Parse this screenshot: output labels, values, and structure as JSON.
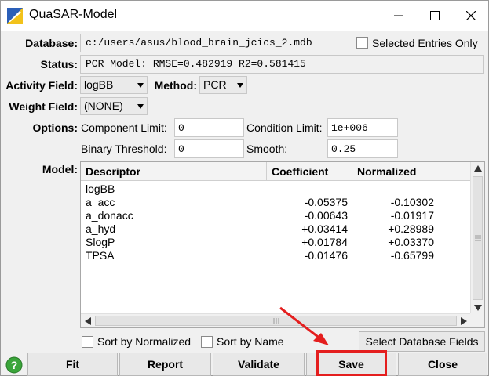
{
  "window": {
    "title": "QuaSAR-Model"
  },
  "labels": {
    "database": "Database:",
    "status": "Status:",
    "activity_field": "Activity Field:",
    "method": "Method:",
    "weight_field": "Weight Field:",
    "options": "Options:",
    "model": "Model:"
  },
  "database": {
    "path": "c:/users/asus/blood_brain_jcics_2.mdb",
    "selected_entries_only": "Selected Entries Only"
  },
  "status": {
    "text": "PCR Model: RMSE=0.482919 R2=0.581415"
  },
  "activity_field": {
    "value": "logBB"
  },
  "method": {
    "value": "PCR"
  },
  "weight_field": {
    "value": "(NONE)"
  },
  "options": {
    "component_limit_label": "Component Limit:",
    "component_limit": "0",
    "condition_limit_label": "Condition Limit:",
    "condition_limit": "1e+006",
    "binary_threshold_label": "Binary Threshold:",
    "binary_threshold": "0",
    "smooth_label": "Smooth:",
    "smooth": "0.25"
  },
  "model": {
    "columns": [
      "Descriptor",
      "Coefficient",
      "Normalized"
    ],
    "rows": [
      {
        "descriptor": "logBB",
        "coefficient": "",
        "normalized": ""
      },
      {
        "descriptor": "a_acc",
        "coefficient": "-0.05375",
        "normalized": "-0.10302"
      },
      {
        "descriptor": "a_donacc",
        "coefficient": "-0.00643",
        "normalized": "-0.01917"
      },
      {
        "descriptor": "a_hyd",
        "coefficient": "+0.03414",
        "normalized": "+0.28989"
      },
      {
        "descriptor": "SlogP",
        "coefficient": "+0.01784",
        "normalized": "+0.03370"
      },
      {
        "descriptor": "TPSA",
        "coefficient": "-0.01476",
        "normalized": "-0.65799"
      }
    ]
  },
  "sort": {
    "by_normalized": "Sort by Normalized",
    "by_name": "Sort by Name"
  },
  "select_database_fields": "Select Database Fields",
  "buttons": {
    "fit": "Fit",
    "report": "Report",
    "validate": "Validate",
    "save": "Save",
    "close": "Close"
  },
  "colors": {
    "annotation_red": "#e41e1e",
    "help_green": "#3aa53a"
  }
}
